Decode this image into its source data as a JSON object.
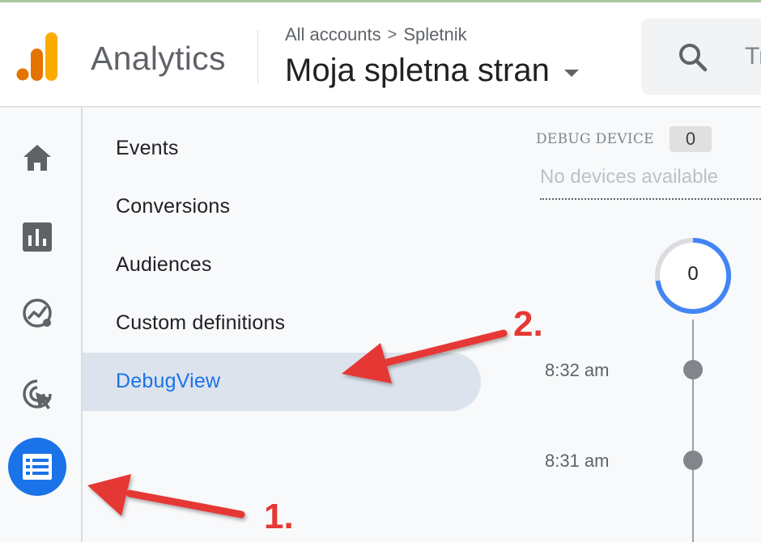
{
  "header": {
    "app_name": "Analytics",
    "breadcrumb": {
      "root": "All accounts",
      "separator": ">",
      "child": "Spletnik"
    },
    "property_name": "Moja spletna stran",
    "search_partial": "Tr"
  },
  "rail": {
    "icons": [
      "home-icon",
      "reports-icon",
      "explore-icon",
      "advertising-icon",
      "configure-icon"
    ],
    "active": "configure-icon"
  },
  "submenu": {
    "items": [
      {
        "label": "Events"
      },
      {
        "label": "Conversions"
      },
      {
        "label": "Audiences"
      },
      {
        "label": "Custom definitions"
      },
      {
        "label": "DebugView"
      }
    ],
    "active_index": 4
  },
  "debug": {
    "device_label": "DEBUG DEVICE",
    "device_count": "0",
    "no_devices": "No devices available",
    "counter_value": "0",
    "timeline": [
      {
        "time": "8:32 am"
      },
      {
        "time": "8:31 am"
      }
    ]
  },
  "annotations": {
    "first": "1.",
    "second": "2."
  },
  "colors": {
    "accent": "#1a73e8",
    "annotation": "#e53935",
    "logo_orange": "#f9ab00",
    "logo_dark": "#e37400"
  }
}
